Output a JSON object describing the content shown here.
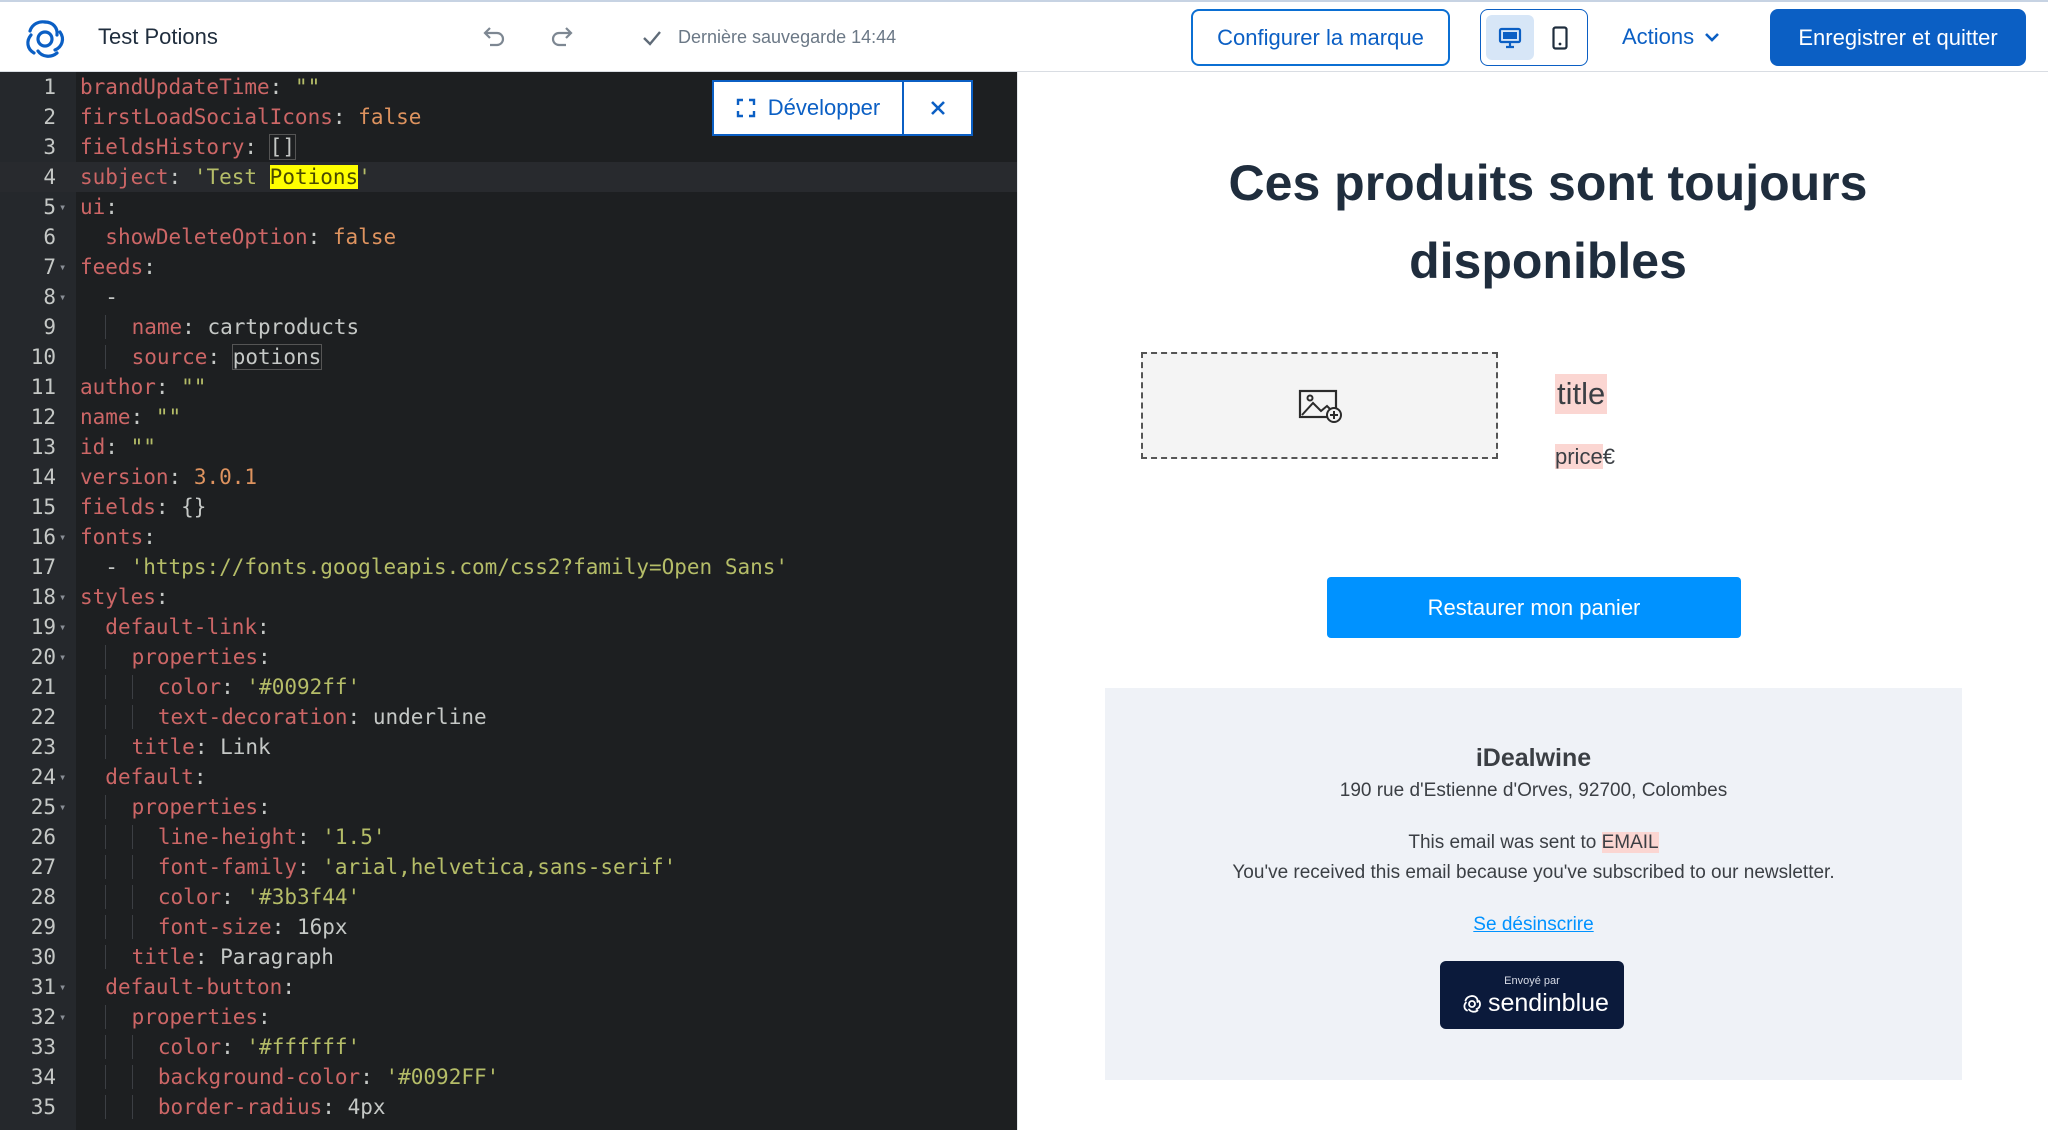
{
  "header": {
    "title": "Test Potions",
    "save_status": "Dernière sauvegarde 14:44",
    "brand_button": "Configurer la marque",
    "actions_label": "Actions",
    "save_quit_button": "Enregistrer et quitter"
  },
  "editor": {
    "expand_label": "Développer",
    "lines": [
      {
        "n": "1",
        "fold": false
      },
      {
        "n": "2",
        "fold": false
      },
      {
        "n": "3",
        "fold": false
      },
      {
        "n": "4",
        "fold": false
      },
      {
        "n": "5",
        "fold": true
      },
      {
        "n": "6",
        "fold": false
      },
      {
        "n": "7",
        "fold": true
      },
      {
        "n": "8",
        "fold": true
      },
      {
        "n": "9",
        "fold": false
      },
      {
        "n": "10",
        "fold": false
      },
      {
        "n": "11",
        "fold": false
      },
      {
        "n": "12",
        "fold": false
      },
      {
        "n": "13",
        "fold": false
      },
      {
        "n": "14",
        "fold": false
      },
      {
        "n": "15",
        "fold": false
      },
      {
        "n": "16",
        "fold": true
      },
      {
        "n": "17",
        "fold": false
      },
      {
        "n": "18",
        "fold": true
      },
      {
        "n": "19",
        "fold": true
      },
      {
        "n": "20",
        "fold": true
      },
      {
        "n": "21",
        "fold": false
      },
      {
        "n": "22",
        "fold": false
      },
      {
        "n": "23",
        "fold": false
      },
      {
        "n": "24",
        "fold": true
      },
      {
        "n": "25",
        "fold": true
      },
      {
        "n": "26",
        "fold": false
      },
      {
        "n": "27",
        "fold": false
      },
      {
        "n": "28",
        "fold": false
      },
      {
        "n": "29",
        "fold": false
      },
      {
        "n": "30",
        "fold": false
      },
      {
        "n": "31",
        "fold": true
      },
      {
        "n": "32",
        "fold": true
      },
      {
        "n": "33",
        "fold": false
      },
      {
        "n": "34",
        "fold": false
      },
      {
        "n": "35",
        "fold": false
      }
    ],
    "code": {
      "l1_key": "brandUpdateTime",
      "l1_val": "\"\"",
      "l2_key": "firstLoadSocialIcons",
      "l2_val": "false",
      "l3_key": "fieldsHistory",
      "l3_val": "[]",
      "l4_key": "subject",
      "l4_pre": "'Test ",
      "l4_hl": "Potions",
      "l4_post": "'",
      "l5_key": "ui",
      "l6_key": "showDeleteOption",
      "l6_val": "false",
      "l7_key": "feeds",
      "l8_dash": "-",
      "l9_key": "name",
      "l9_val": "cartproducts",
      "l10_key": "source",
      "l10_val": "potions",
      "l11_key": "author",
      "l11_val": "\"\"",
      "l12_key": "name",
      "l12_val": "\"\"",
      "l13_key": "id",
      "l13_val": "\"\"",
      "l14_key": "version",
      "l14_val": "3.0.1",
      "l15_key": "fields",
      "l15_val": "{}",
      "l16_key": "fonts",
      "l17_dash": "-",
      "l17_val": "'https://fonts.googleapis.com/css2?family=Open Sans'",
      "l18_key": "styles",
      "l19_key": "default-link",
      "l20_key": "properties",
      "l21_key": "color",
      "l21_val": "'#0092ff'",
      "l22_key": "text-decoration",
      "l22_val": "underline",
      "l23_key": "title",
      "l23_val": "Link",
      "l24_key": "default",
      "l25_key": "properties",
      "l26_key": "line-height",
      "l26_val": "'1.5'",
      "l27_key": "font-family",
      "l27_val": "'arial,helvetica,sans-serif'",
      "l28_key": "color",
      "l28_val": "'#3b3f44'",
      "l29_key": "font-size",
      "l29_val": "16px",
      "l30_key": "title",
      "l30_val": "Paragraph",
      "l31_key": "default-button",
      "l32_key": "properties",
      "l33_key": "color",
      "l33_val": "'#ffffff'",
      "l34_key": "background-color",
      "l34_val": "'#0092FF'",
      "l35_key": "border-radius",
      "l35_val": "4px"
    }
  },
  "preview": {
    "headline": "Ces produits sont toujours disponibles",
    "product_title": "title",
    "product_price_tag": "price",
    "product_price_currency": "€",
    "restore_button": "Restaurer mon panier",
    "footer": {
      "company": "iDealwine",
      "address": "190 rue d'Estienne d'Orves, 92700, Colombes",
      "sent_prefix": "This email was sent to ",
      "sent_tag": "EMAIL",
      "reason": "You've received this email because you've subscribed to our newsletter.",
      "unsubscribe": "Se désinscrire",
      "badge_small": "Envoyé par",
      "badge_brand": "sendinblue"
    }
  },
  "colors": {
    "accent": "#0b5fc4",
    "button_blue": "#0092ff",
    "editor_bg": "#1d1f21",
    "highlight": "#ffff00",
    "merge_tag": "#fbd6d2"
  },
  "icons": {
    "logo": "sendinblue-logo-icon",
    "undo": "undo-icon",
    "redo": "redo-icon",
    "check": "check-icon",
    "desktop": "desktop-icon",
    "mobile": "mobile-icon",
    "chevron": "chevron-down-icon",
    "expand": "expand-icon",
    "close": "close-icon",
    "image": "image-add-icon"
  }
}
